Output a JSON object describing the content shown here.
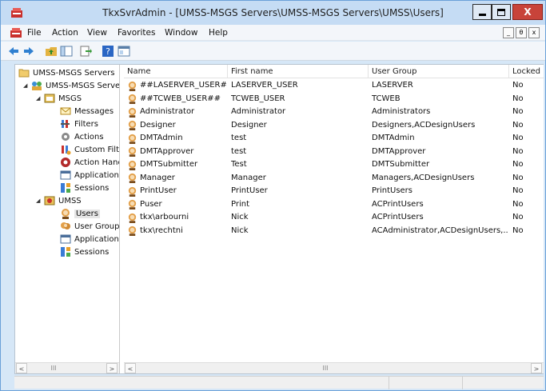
{
  "window": {
    "title": "TkxSvrAdmin - [UMSS-MSGS Servers\\UMSS-MSGS Servers\\UMSS\\Users]",
    "close_label": "X"
  },
  "menubar": {
    "items": [
      "File",
      "Action",
      "View",
      "Favorites",
      "Window",
      "Help"
    ]
  },
  "mdi_controls": [
    "_",
    "θ",
    "x"
  ],
  "tree": {
    "root": "UMSS-MSGS Servers",
    "server": "UMSS-MSGS Server",
    "msgs": "MSGS",
    "msgs_children": [
      "Messages",
      "Filters",
      "Actions",
      "Custom Filte",
      "Action Hand",
      "Application",
      "Sessions"
    ],
    "umss": "UMSS",
    "umss_children": [
      "Users",
      "User Groups",
      "Application",
      "Sessions"
    ]
  },
  "list": {
    "columns": [
      "Name",
      "First name",
      "User Group",
      "Locked"
    ],
    "rows": [
      [
        "##LASERVER_USER##",
        "LASERVER_USER",
        "LASERVER",
        "No"
      ],
      [
        "##TCWEB_USER##",
        "TCWEB_USER",
        "TCWEB",
        "No"
      ],
      [
        "Administrator",
        "Administrator",
        "Administrators",
        "No"
      ],
      [
        "Designer",
        "Designer",
        "Designers,ACDesignUsers",
        "No"
      ],
      [
        "DMTAdmin",
        "test",
        "DMTAdmin",
        "No"
      ],
      [
        "DMTApprover",
        "test",
        "DMTApprover",
        "No"
      ],
      [
        "DMTSubmitter",
        "Test",
        "DMTSubmitter",
        "No"
      ],
      [
        "Manager",
        "Manager",
        "Managers,ACDesignUsers",
        "No"
      ],
      [
        "PrintUser",
        "PrintUser",
        "PrintUsers",
        "No"
      ],
      [
        "Puser",
        "Print",
        "ACPrintUsers",
        "No"
      ],
      [
        "tkx\\arbourni",
        "Nick",
        "ACPrintUsers",
        "No"
      ],
      [
        "tkx\\rechtni",
        "Nick",
        "ACAdministrator,ACDesignUsers,...",
        "No"
      ]
    ]
  },
  "scrollbars": {
    "left_arrow": "<",
    "right_arrow": ">",
    "thumb": "III"
  },
  "colors": {
    "title_bg": "#c5dcf4",
    "close_red": "#c8433a",
    "window_border": "#6aa0d8"
  }
}
